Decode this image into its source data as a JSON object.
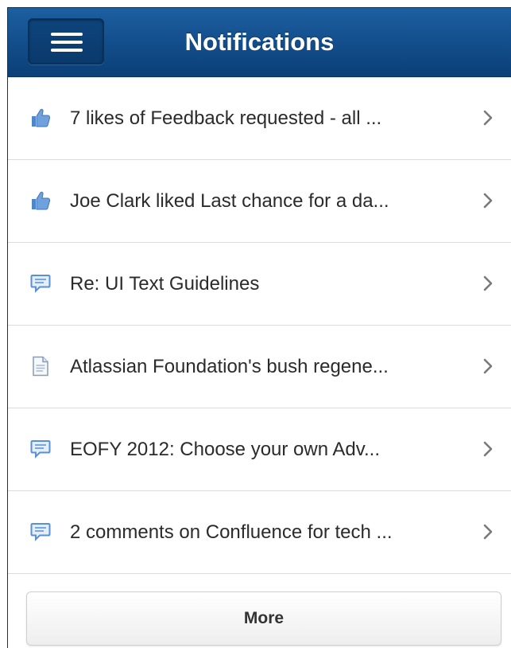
{
  "header": {
    "title": "Notifications",
    "menu_icon": "hamburger-menu-icon"
  },
  "notifications": [
    {
      "icon": "thumbs-up-icon",
      "text": "7 likes of Feedback requested - all ..."
    },
    {
      "icon": "thumbs-up-icon",
      "text": "Joe Clark liked Last chance for a da..."
    },
    {
      "icon": "comment-icon",
      "text": "Re: UI Text Guidelines"
    },
    {
      "icon": "document-icon",
      "text": "Atlassian Foundation's bush regene..."
    },
    {
      "icon": "comment-icon",
      "text": "EOFY 2012: Choose your own Adv..."
    },
    {
      "icon": "comment-icon",
      "text": "2 comments on Confluence for tech ..."
    }
  ],
  "more_button": {
    "label": "More"
  },
  "colors": {
    "header_top": "#1d5fa0",
    "header_bottom": "#0b3f77",
    "icon_blue": "#5a8fd0",
    "chevron": "#7a7a7a",
    "divider": "#dcdcdc"
  }
}
